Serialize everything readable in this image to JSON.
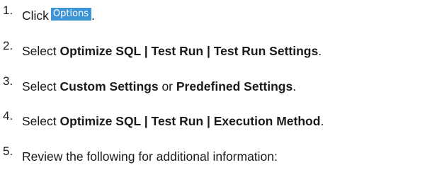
{
  "steps": [
    {
      "number": "1.",
      "prefix": "Click",
      "button_label": "Options",
      "suffix": "."
    },
    {
      "number": "2.",
      "prefix": "Select",
      "bold": "Optimize SQL | Test Run | Test Run Settings",
      "suffix": "."
    },
    {
      "number": "3.",
      "prefix": "Select",
      "bold_a": "Custom Settings",
      "connector": "or",
      "bold_b": "Predefined Settings",
      "suffix": "."
    },
    {
      "number": "4.",
      "prefix": "Select",
      "bold": "Optimize SQL | Test Run | Execution Method",
      "suffix": "."
    },
    {
      "number": "5.",
      "text": "Review the following for additional information:"
    }
  ]
}
